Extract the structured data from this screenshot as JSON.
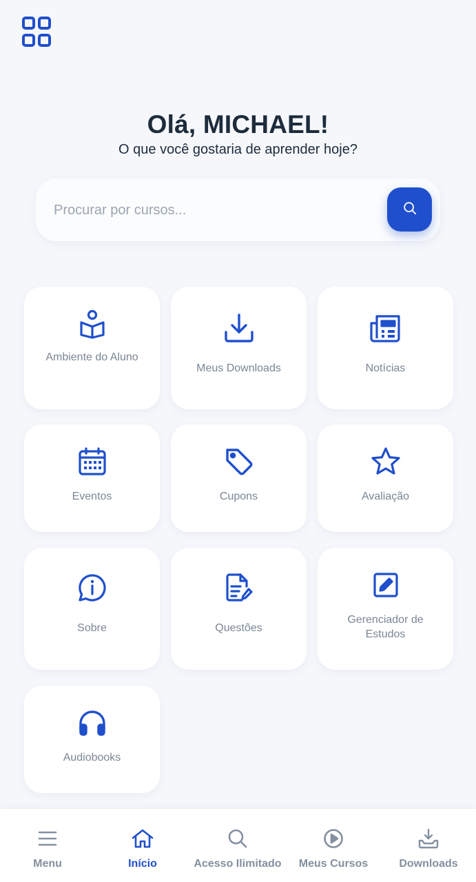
{
  "header": {
    "greeting": "Olá, MICHAEL!",
    "subtitle": "O que você gostaria de aprender hoje?"
  },
  "search": {
    "placeholder": "Procurar por cursos...",
    "value": ""
  },
  "grid": {
    "items": [
      {
        "label": "Ambiente do Aluno",
        "icon": "student-reading-icon"
      },
      {
        "label": "Meus Downloads",
        "icon": "download-icon"
      },
      {
        "label": "Notícias",
        "icon": "newspaper-icon"
      },
      {
        "label": "Eventos",
        "icon": "calendar-icon"
      },
      {
        "label": "Cupons",
        "icon": "tag-icon"
      },
      {
        "label": "Avaliação",
        "icon": "star-icon"
      },
      {
        "label": "Sobre",
        "icon": "info-chat-icon"
      },
      {
        "label": "Questões",
        "icon": "file-edit-icon"
      },
      {
        "label": "Gerenciador de Estudos",
        "icon": "edit-square-icon"
      },
      {
        "label": "Audiobooks",
        "icon": "headphones-icon"
      }
    ]
  },
  "nav": {
    "items": [
      {
        "label": "Menu",
        "icon": "hamburger-icon",
        "active": false
      },
      {
        "label": "Início",
        "icon": "home-icon",
        "active": true
      },
      {
        "label": "Acesso Ilimitado",
        "icon": "search-icon",
        "active": false
      },
      {
        "label": "Meus Cursos",
        "icon": "play-circle-icon",
        "active": false
      },
      {
        "label": "Downloads",
        "icon": "inbox-download-icon",
        "active": false
      }
    ]
  },
  "colors": {
    "accent": "#1f4fcc",
    "background": "#f5f7fb",
    "muted": "#7a8695"
  }
}
